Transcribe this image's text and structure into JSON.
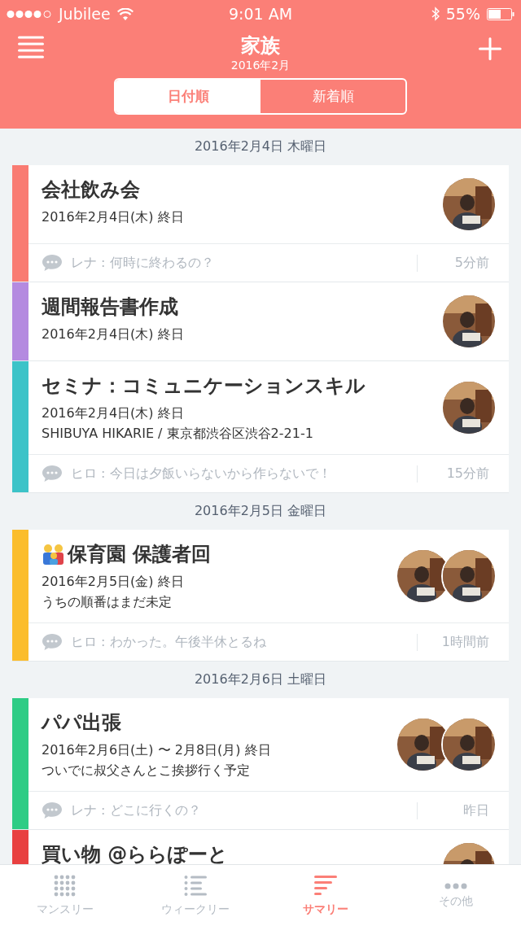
{
  "status_bar": {
    "carrier": "Jubilee",
    "time": "9:01 AM",
    "battery": "55%"
  },
  "header": {
    "title": "家族",
    "subtitle": "2016年2月"
  },
  "segments": [
    {
      "label": "日付順",
      "selected": true
    },
    {
      "label": "新着順",
      "selected": false
    }
  ],
  "days": [
    {
      "date": "2016年2月4日 木曜日",
      "events": [
        {
          "color": "#f97b72",
          "title": "会社飲み会",
          "title_icon": false,
          "lines": [
            "2016年2月4日(木) 終日"
          ],
          "avatars": [
            {
              "kind": "picture"
            }
          ],
          "comment": {
            "text": "レナ : 何時に終わるの？",
            "time": "5分前"
          }
        },
        {
          "color": "#b48ae0",
          "title": "週間報告書作成",
          "title_icon": false,
          "lines": [
            "2016年2月4日(木) 終日"
          ],
          "avatars": [
            {
              "kind": "picture"
            }
          ]
        },
        {
          "color": "#3cc3c8",
          "title": "セミナ：コミュニケーションスキル",
          "title_icon": false,
          "lines": [
            "2016年2月4日(木) 終日",
            "SHIBUYA HIKARIE / 東京都渋谷区渋谷2-21-1"
          ],
          "avatars": [
            {
              "kind": "picture"
            }
          ],
          "comment": {
            "text": "ヒロ : 今日は夕飯いらないから作らないで！",
            "time": "15分前"
          }
        }
      ]
    },
    {
      "date": "2016年2月5日 金曜日",
      "events": [
        {
          "color": "#fbbd2c",
          "title": "保育園 保護者回",
          "title_icon": true,
          "lines": [
            "2016年2月5日(金) 終日",
            "うちの順番はまだ未定"
          ],
          "avatars": [
            {
              "kind": "picture"
            },
            {
              "kind": "picture"
            }
          ],
          "comment": {
            "text": "ヒロ : わかった。午後半休とるね",
            "time": "1時間前"
          }
        }
      ]
    },
    {
      "date": "2016年2月6日 土曜日",
      "events": [
        {
          "color": "#2ecc85",
          "title": "パパ出張",
          "title_icon": false,
          "lines": [
            "2016年2月6日(土) 〜 2月8日(月) 終日",
            "ついでに叔父さんとこ挨拶行く予定"
          ],
          "avatars": [
            {
              "kind": "picture"
            },
            {
              "kind": "picture"
            }
          ],
          "comment": {
            "text": "レナ : どこに行くの？",
            "time": "昨日"
          }
        },
        {
          "color": "#e84040",
          "title": "買い物 @ららぽーと",
          "title_icon": false,
          "avatars": [
            {
              "kind": "picture"
            }
          ]
        }
      ]
    }
  ],
  "tab_bar": [
    {
      "label": "マンスリー",
      "kind": "grid",
      "selected": false
    },
    {
      "label": "ウィークリー",
      "kind": "list",
      "selected": false
    },
    {
      "label": "サマリー",
      "kind": "summary",
      "selected": true
    },
    {
      "label": "その他",
      "kind": "more",
      "selected": false
    }
  ]
}
